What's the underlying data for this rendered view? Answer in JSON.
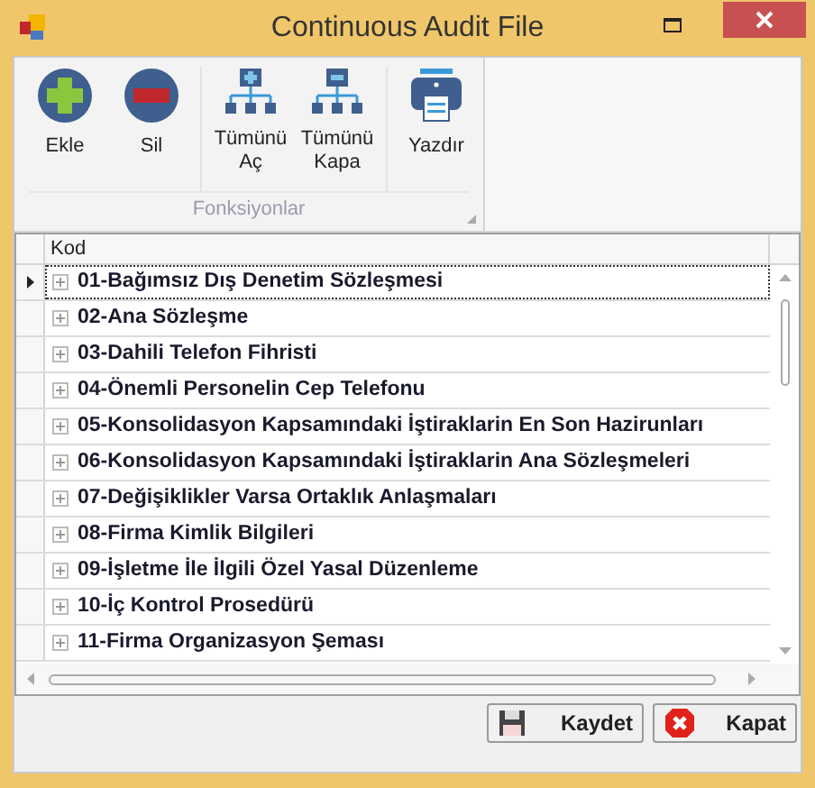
{
  "window": {
    "title": "Continuous Audit File"
  },
  "ribbon": {
    "groups": [
      {
        "items": [
          {
            "kind": "add",
            "label": "Ekle"
          },
          {
            "kind": "remove",
            "label": "Sil"
          }
        ]
      },
      {
        "items": [
          {
            "kind": "expand",
            "label": "Tümünü Aç"
          },
          {
            "kind": "collapse",
            "label": "Tümünü Kapa"
          }
        ]
      },
      {
        "items": [
          {
            "kind": "print",
            "label": "Yazdır"
          }
        ]
      }
    ],
    "caption": "Fonksiyonlar"
  },
  "table": {
    "columns": [
      "Kod"
    ],
    "rows": [
      {
        "text": "01-Bağımsız Dış Denetim Sözleşmesi",
        "selected": true,
        "expanded": false
      },
      {
        "text": "02-Ana Sözleşme",
        "selected": false,
        "expanded": false
      },
      {
        "text": "03-Dahili Telefon Fihristi",
        "selected": false,
        "expanded": false
      },
      {
        "text": "04-Önemli Personelin Cep Telefonu",
        "selected": false,
        "expanded": false
      },
      {
        "text": "05-Konsolidasyon Kapsamındaki İştiraklarin En Son Hazirunları",
        "selected": false,
        "expanded": false
      },
      {
        "text": "06-Konsolidasyon Kapsamındaki İştiraklarin Ana Sözleşmeleri",
        "selected": false,
        "expanded": false
      },
      {
        "text": "07-Değişiklikler Varsa Ortaklık Anlaşmaları",
        "selected": false,
        "expanded": false
      },
      {
        "text": "08-Firma Kimlik Bilgileri",
        "selected": false,
        "expanded": false
      },
      {
        "text": "09-İşletme İle İlgili Özel Yasal Düzenleme",
        "selected": false,
        "expanded": false
      },
      {
        "text": "10-İç Kontrol Prosedürü",
        "selected": false,
        "expanded": false
      },
      {
        "text": "11-Firma Organizasyon Şeması",
        "selected": false,
        "expanded": false
      }
    ]
  },
  "buttons": [
    {
      "kind": "save",
      "label": "Kaydet"
    },
    {
      "kind": "close",
      "label": "Kapat"
    }
  ]
}
